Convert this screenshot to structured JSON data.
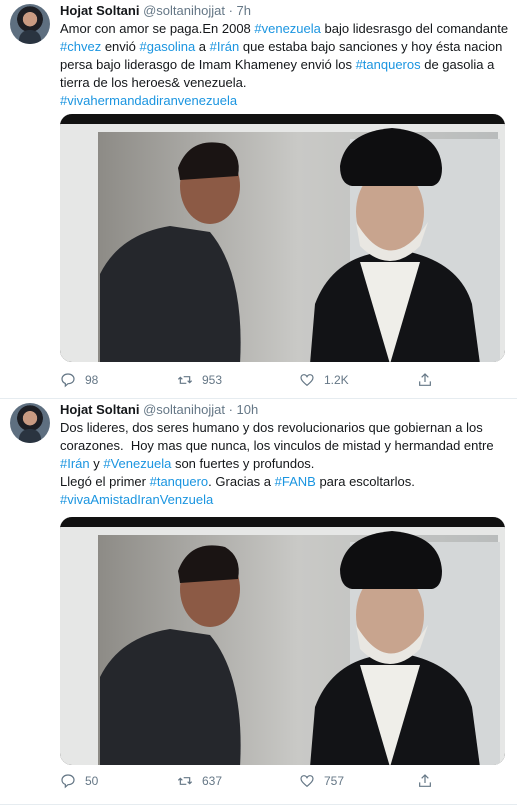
{
  "tweets": [
    {
      "author": "Hojat Soltani",
      "handle": "@soltanihojjat",
      "separator": "·",
      "time": "7h",
      "lines": [
        [
          {
            "t": "Amor con amor se paga.En 2008 "
          },
          {
            "t": "#venezuela",
            "tag": true
          },
          {
            "t": " bajo lidesrasgo del comandante"
          }
        ],
        [
          {
            "t": "#chvez",
            "tag": true
          },
          {
            "t": " envió "
          },
          {
            "t": "#gasolina",
            "tag": true
          },
          {
            "t": " a "
          },
          {
            "t": "#Irán",
            "tag": true
          },
          {
            "t": " que estaba bajo sanciones y hoy ésta nacion"
          }
        ],
        [
          {
            "t": "persa bajo liderasgo de Imam Khameney envió los "
          },
          {
            "t": "#tanqueros",
            "tag": true
          },
          {
            "t": " de gasolia a"
          }
        ],
        [
          {
            "t": "tierra de los heroes& venezuela."
          }
        ],
        [
          {
            "t": "#vivahermandadiranvenezuela",
            "tag": true
          }
        ]
      ],
      "reply_count": "98",
      "retweet_count": "953",
      "like_count": "1.2K"
    },
    {
      "author": "Hojat Soltani",
      "handle": "@soltanihojjat",
      "separator": "·",
      "time": "10h",
      "lines": [
        [
          {
            "t": "Dos lideres, dos seres humano y dos revolucionarios que gobiernan a los"
          }
        ],
        [
          {
            "t": "corazones.  Hoy mas que nunca, los vinculos de mistad y hermandad entre"
          }
        ],
        [
          {
            "t": "#Irán",
            "tag": true
          },
          {
            "t": " y "
          },
          {
            "t": "#Venezuela",
            "tag": true
          },
          {
            "t": " son fuertes y profundos."
          }
        ],
        [
          {
            "t": "Llegó el primer "
          },
          {
            "t": "#tanquero",
            "tag": true
          },
          {
            "t": ". Gracias a "
          },
          {
            "t": "#FANB",
            "tag": true
          },
          {
            "t": " para escoltarlos."
          }
        ],
        [
          {
            "t": "#vivaAmistadIranVenzuela",
            "tag": true
          }
        ]
      ],
      "reply_count": "50",
      "retweet_count": "637",
      "like_count": "757"
    }
  ],
  "icons": {
    "reply": "reply-icon",
    "retweet": "retweet-icon",
    "like": "heart-icon",
    "share": "share-icon"
  },
  "colors": {
    "hashtag": "#1b95e0",
    "secondary_text": "#657786",
    "primary_text": "#14171a",
    "divider": "#e6ecf0"
  }
}
